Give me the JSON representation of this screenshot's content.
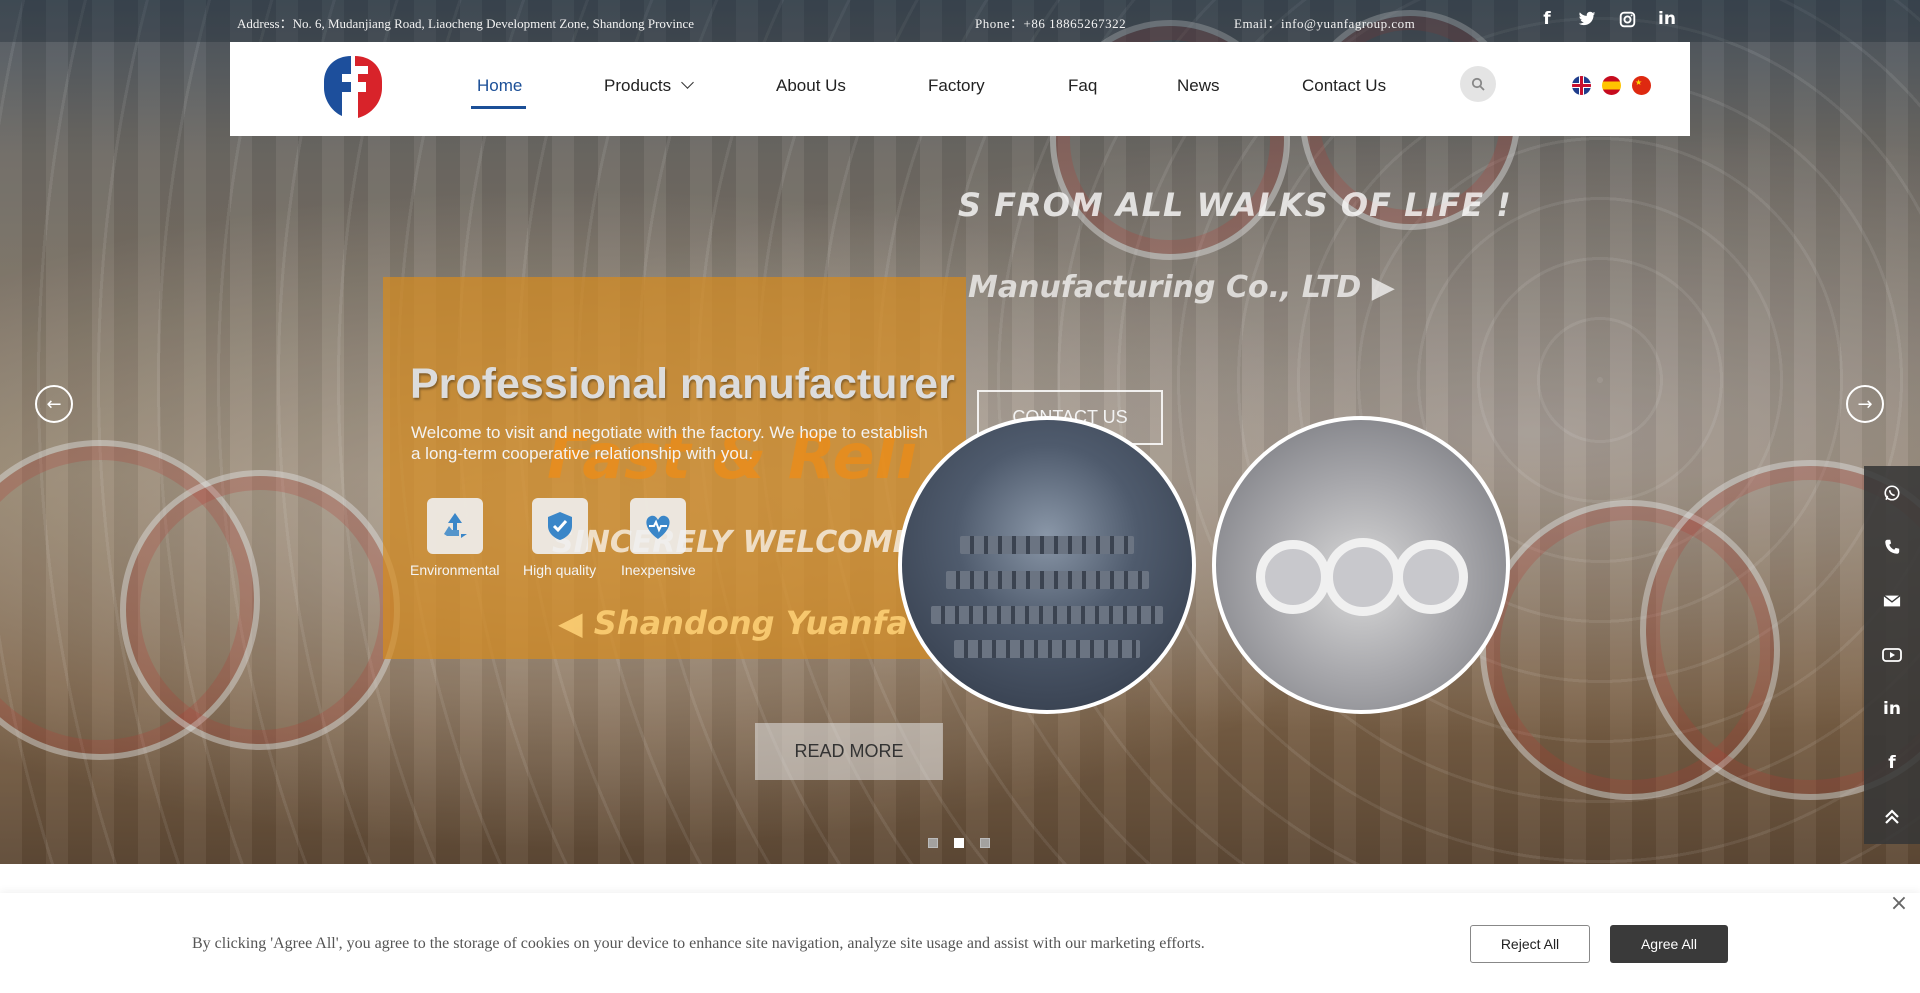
{
  "topbar": {
    "address": "Address：No. 6, Mudanjiang Road, Liaocheng Development Zone, Shandong Province",
    "phone": "Phone：+86 18865267322",
    "email": "Email：info@yuanfagroup.com",
    "social_icons": [
      "facebook-icon",
      "twitter-icon",
      "instagram-icon",
      "linkedin-icon"
    ]
  },
  "nav": {
    "items": [
      {
        "label": "Home",
        "active": true
      },
      {
        "label": "Products",
        "has_dropdown": true
      },
      {
        "label": "About Us"
      },
      {
        "label": "Factory"
      },
      {
        "label": "Faq"
      },
      {
        "label": "News"
      },
      {
        "label": "Contact Us"
      }
    ],
    "languages": [
      "en-flag-icon",
      "es-flag-icon",
      "cn-flag-icon"
    ],
    "accent_color": "#1b4f97"
  },
  "hero": {
    "title": "Professional manufacturer",
    "description": "Welcome to visit and negotiate with the factory. We hope to establish a long-term cooperative relationship with you.",
    "features": [
      {
        "label": "Environmental",
        "icon": "recycle-icon"
      },
      {
        "label": "High quality",
        "icon": "shield-check-icon"
      },
      {
        "label": "Inexpensive",
        "icon": "heart-pulse-icon"
      }
    ],
    "contact_button": "CONTACT US",
    "read_more_button": "READ MORE",
    "overlay_texts": {
      "line1": "S FROM ALL WALKS OF LIFE !",
      "line2": "Manufacturing Co., LTD ▶",
      "line3": "Fast & Reli",
      "line4": "SINCERELY WELCOME FRIEN",
      "line5": "◀ Shandong Yuanfa Metal"
    },
    "slide_count": 3,
    "active_slide": 2,
    "panel_color": "#d68a1e"
  },
  "rail": {
    "icons": [
      "whatsapp-icon",
      "phone-icon",
      "email-icon",
      "youtube-icon",
      "linkedin-icon",
      "facebook-icon",
      "back-to-top-icon"
    ]
  },
  "cookie": {
    "text": "By clicking 'Agree All', you agree to the storage of cookies on your device to enhance site navigation, analyze site usage and assist with our marketing efforts.",
    "reject_label": "Reject All",
    "agree_label": "Agree All"
  }
}
